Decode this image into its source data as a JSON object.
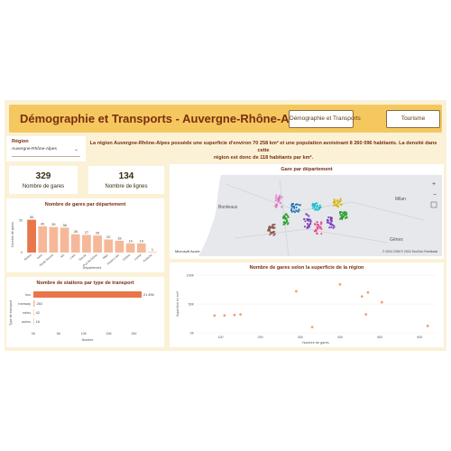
{
  "header": {
    "title": "Démographie et Transports - Auvergne-Rhône-Alpes",
    "btn_demo": "Démographie et Transports",
    "btn_tourisme": "Tourisme"
  },
  "filter": {
    "label": "Région",
    "selected": "Auvergne-Rhône-Alpes"
  },
  "description": {
    "line1": "La région Auvergne-Rhône-Alpes possède une superficie d'environ 70 258 km² et une population avoisinant 8 260 096 habitants. La densité dans cette",
    "line2": "région est donc de  118 habitants par km²."
  },
  "kpis": {
    "gares_value": "329",
    "gares_label": "Nombre de gares",
    "lignes_value": "134",
    "lignes_label": "Nombre de lignes"
  },
  "map": {
    "title": "Gare par département",
    "labels": [
      "Bordeaux",
      "Milan",
      "Gênes",
      "Lyon"
    ],
    "attribution": "© 2024 OSM  © 2024 TomTom  Feedback",
    "logo": "Microsoft Azure",
    "colors": [
      "#1f77b4",
      "#7b3fb6",
      "#e84b8a",
      "#2ca02c",
      "#17becf",
      "#d6b400",
      "#8c564b",
      "#e377c2"
    ]
  },
  "chart_data": [
    {
      "type": "bar",
      "title": "Nombre de gares par département",
      "xlabel": "Département",
      "ylabel": "Nombre de gares",
      "categories": [
        "Rhône",
        "Isère",
        "Haute-Savoie",
        "Ain",
        "Loire",
        "Savoie",
        "Puy-de-Dôme",
        "Allier",
        "Haute-Loire",
        "Drôme",
        "Cantal",
        "Ardèche"
      ],
      "values": [
        50,
        40,
        39,
        38,
        28,
        27,
        26,
        20,
        18,
        14,
        14,
        1
      ],
      "labels": [
        "50",
        "40",
        "39",
        "38",
        "28",
        "27",
        "26",
        "20",
        "18",
        "14",
        "14",
        "1"
      ],
      "colors": {
        "highlight": "#e8764a",
        "normal": "#f5b99a"
      }
    },
    {
      "type": "bar",
      "orientation": "horizontal",
      "title": "Nombre de stations par type de transport",
      "xlabel": "Nombre",
      "ylabel": "Type de transport",
      "categories": [
        "bus",
        "tramway",
        "métro",
        "autres"
      ],
      "values": [
        21496,
        263,
        42,
        16
      ],
      "labels": [
        "21 496",
        "263",
        "42",
        "16"
      ],
      "xticks": [
        "0K",
        "5K",
        "10K",
        "15K",
        "20K"
      ],
      "xlim": [
        0,
        21496
      ],
      "colors": {
        "highlight": "#e8764a",
        "normal": "#f5b99a"
      }
    },
    {
      "type": "scatter",
      "title": "Nombre de gares selon la superficie de la région",
      "xlabel": "Nombre de gares",
      "ylabel": "Superficie en km²",
      "xticks": [
        "100",
        "200",
        "300",
        "400",
        "500",
        "600"
      ],
      "yticks": [
        "0K",
        "50K",
        "100K"
      ],
      "xlim": [
        40,
        640
      ],
      "ylim": [
        0,
        100000
      ],
      "x": [
        85,
        110,
        135,
        150,
        290,
        330,
        400,
        455,
        465,
        470,
        505,
        620
      ],
      "y": [
        30000,
        30000,
        31000,
        32000,
        72000,
        10000,
        84000,
        63000,
        32000,
        70000,
        53000,
        12000
      ],
      "color": "#f0a070"
    }
  ]
}
